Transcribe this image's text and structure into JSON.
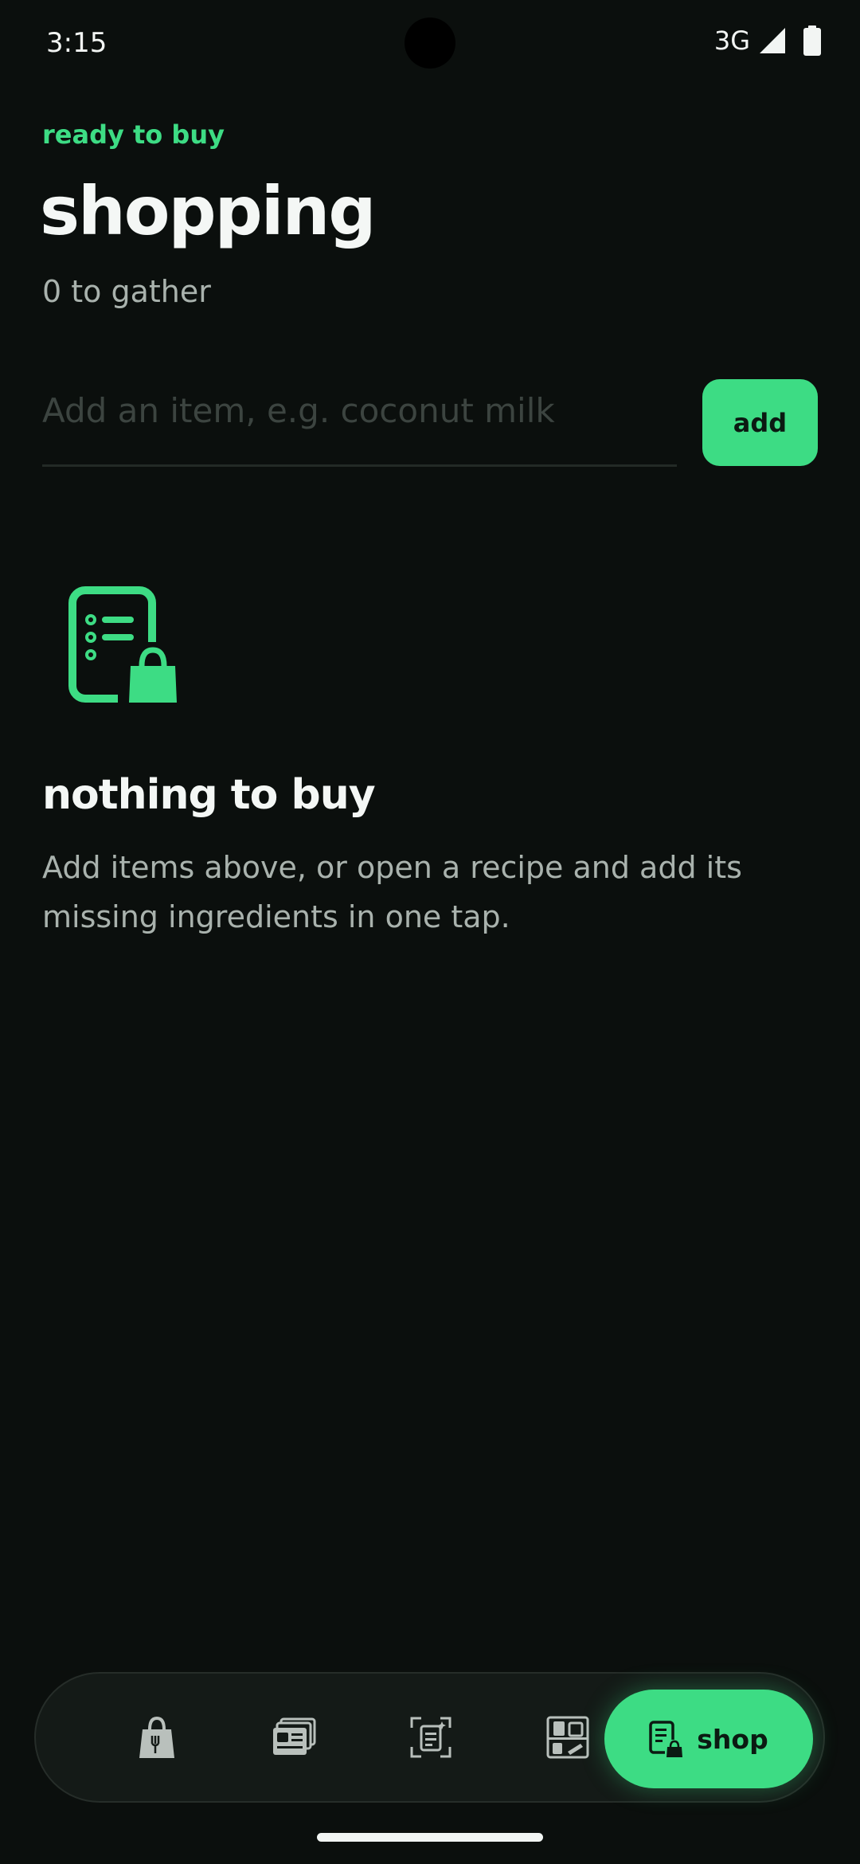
{
  "status_bar": {
    "time": "3:15",
    "network": "3G",
    "signal_icon": "signal-icon",
    "battery_icon": "battery-icon"
  },
  "header": {
    "eyebrow": "ready to buy",
    "title": "shopping",
    "count_text": "0 to gather"
  },
  "add_item": {
    "placeholder": "Add an item, e.g. coconut milk",
    "value": "",
    "button_label": "add"
  },
  "empty_state": {
    "icon": "shopping-list-bag-icon",
    "title": "nothing to buy",
    "body": "Add items above, or open a recipe and add its missing ingredients in one tap."
  },
  "bottom_nav": {
    "items": [
      {
        "icon": "pantry-bag-icon",
        "label": ""
      },
      {
        "icon": "recipes-cards-icon",
        "label": ""
      },
      {
        "icon": "scan-icon",
        "label": ""
      },
      {
        "icon": "fridge-plan-icon",
        "label": ""
      },
      {
        "icon": "shopping-list-bag-icon",
        "label": "shop"
      }
    ],
    "active_index": 4
  },
  "colors": {
    "background": "#0b0f0d",
    "accent": "#3ddc84",
    "text_primary": "#f4f7f5",
    "text_secondary": "#a9b2ad",
    "placeholder": "#3c4440",
    "nav_background": "#141a17"
  }
}
